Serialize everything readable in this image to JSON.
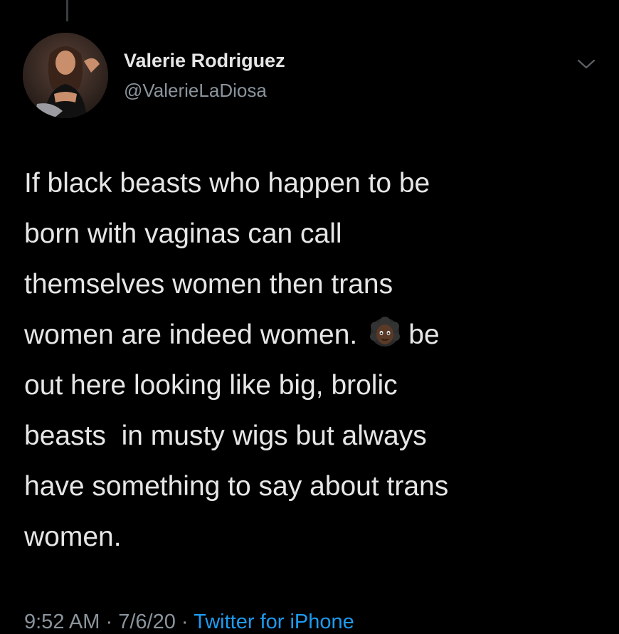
{
  "tweet": {
    "author": {
      "display_name": "Valerie Rodriguez",
      "handle": "@ValerieLaDiosa",
      "avatar_icon": "profile-photo"
    },
    "menu_icon": "chevron-down-icon",
    "text_lines": {
      "l1": "If black beasts who happen to be",
      "l2": "born with vaginas can call",
      "l3": "themselves women then trans",
      "l4_before": "women are indeed women.",
      "l4_emoji": "woman-dark-skin-tone-emoji",
      "l4_after": "be",
      "l5": "out here looking like big, brolic",
      "l6": "beasts  in musty wigs but always",
      "l7": "have something to say about trans",
      "l8": "women."
    },
    "time": "9:52 AM",
    "separator": "·",
    "date": "7/6/20",
    "source": "Twitter for iPhone"
  },
  "colors": {
    "background": "#000000",
    "text": "#e6e6e6",
    "muted": "#8b949c",
    "link": "#1d9bf0"
  }
}
